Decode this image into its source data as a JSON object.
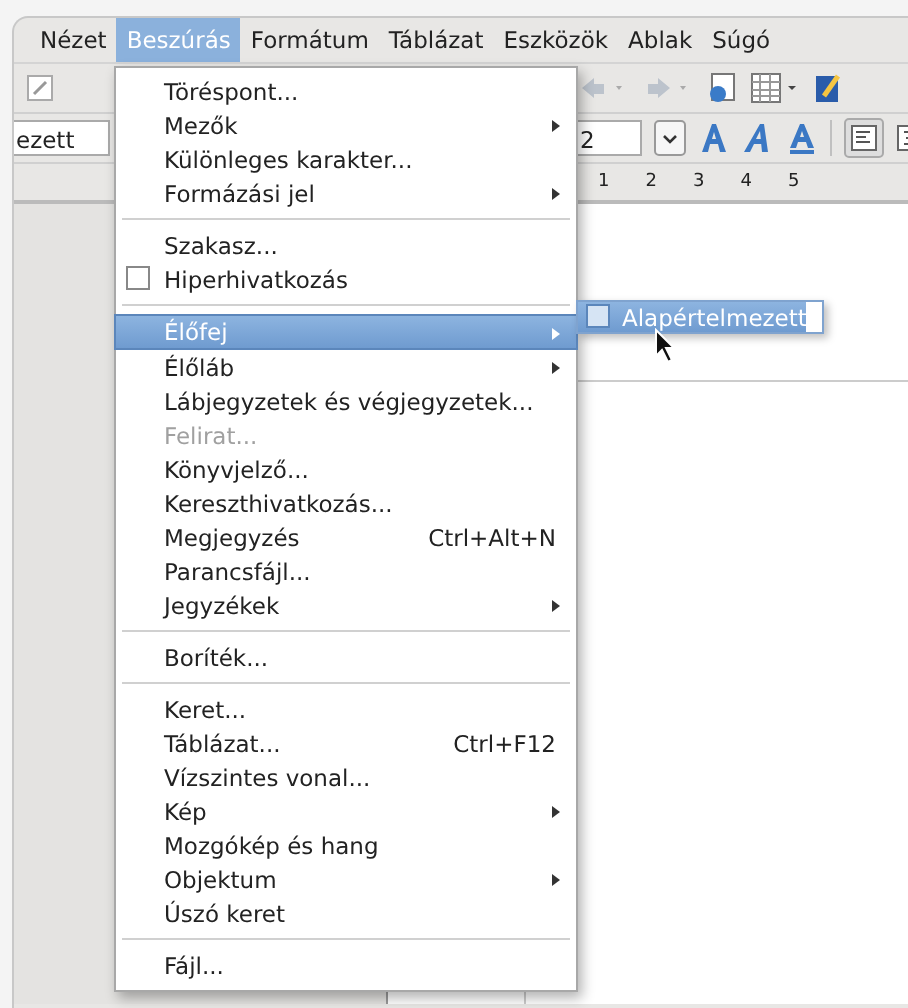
{
  "menubar": [
    {
      "label": "Nézet",
      "selected": false
    },
    {
      "label": "Beszúrás",
      "selected": true
    },
    {
      "label": "Formátum",
      "selected": false
    },
    {
      "label": "Táblázat",
      "selected": false
    },
    {
      "label": "Eszközök",
      "selected": false
    },
    {
      "label": "Ablak",
      "selected": false
    },
    {
      "label": "Súgó",
      "selected": false
    }
  ],
  "formatting": {
    "style_field": "ezett",
    "size_field": "2"
  },
  "ruler": [
    "1",
    "2",
    "3",
    "4",
    "5"
  ],
  "menu": [
    {
      "kind": "item",
      "label": "Töréspont...",
      "submenu": false,
      "disabled": false,
      "selected": false
    },
    {
      "kind": "item",
      "label": "Mezők",
      "submenu": true,
      "disabled": false,
      "selected": false
    },
    {
      "kind": "item",
      "label": "Különleges karakter...",
      "submenu": false,
      "disabled": false,
      "selected": false
    },
    {
      "kind": "item",
      "label": "Formázási jel",
      "submenu": true,
      "disabled": false,
      "selected": false
    },
    {
      "kind": "separator"
    },
    {
      "kind": "item",
      "label": "Szakasz...",
      "submenu": false,
      "disabled": false,
      "selected": false
    },
    {
      "kind": "check",
      "label": "Hiperhivatkozás",
      "checked": false,
      "disabled": false,
      "selected": false
    },
    {
      "kind": "separator"
    },
    {
      "kind": "item",
      "label": "Élőfej",
      "submenu": true,
      "disabled": false,
      "selected": true
    },
    {
      "kind": "item",
      "label": "Élőláb",
      "submenu": true,
      "disabled": false,
      "selected": false
    },
    {
      "kind": "item",
      "label": "Lábjegyzetek és végjegyzetek...",
      "submenu": false,
      "disabled": false,
      "selected": false
    },
    {
      "kind": "item",
      "label": "Felirat...",
      "submenu": false,
      "disabled": true,
      "selected": false
    },
    {
      "kind": "item",
      "label": "Könyvjelző...",
      "submenu": false,
      "disabled": false,
      "selected": false
    },
    {
      "kind": "item",
      "label": "Kereszthivatkozás...",
      "submenu": false,
      "disabled": false,
      "selected": false
    },
    {
      "kind": "item",
      "label": "Megjegyzés",
      "shortcut": "Ctrl+Alt+N",
      "submenu": false,
      "disabled": false,
      "selected": false
    },
    {
      "kind": "item",
      "label": "Parancsfájl...",
      "submenu": false,
      "disabled": false,
      "selected": false
    },
    {
      "kind": "item",
      "label": "Jegyzékek",
      "submenu": true,
      "disabled": false,
      "selected": false
    },
    {
      "kind": "separator"
    },
    {
      "kind": "item",
      "label": "Boríték...",
      "submenu": false,
      "disabled": false,
      "selected": false
    },
    {
      "kind": "separator"
    },
    {
      "kind": "item",
      "label": "Keret...",
      "submenu": false,
      "disabled": false,
      "selected": false
    },
    {
      "kind": "item",
      "label": "Táblázat...",
      "shortcut": "Ctrl+F12",
      "submenu": false,
      "disabled": false,
      "selected": false
    },
    {
      "kind": "item",
      "label": "Vízszintes vonal...",
      "submenu": false,
      "disabled": false,
      "selected": false
    },
    {
      "kind": "item",
      "label": "Kép",
      "submenu": true,
      "disabled": false,
      "selected": false
    },
    {
      "kind": "item",
      "label": "Mozgókép és hang",
      "submenu": false,
      "disabled": false,
      "selected": false
    },
    {
      "kind": "item",
      "label": "Objektum",
      "submenu": true,
      "disabled": false,
      "selected": false
    },
    {
      "kind": "item",
      "label": "Úszó keret",
      "submenu": false,
      "disabled": false,
      "selected": false
    },
    {
      "kind": "separator"
    },
    {
      "kind": "item",
      "label": "Fájl...",
      "submenu": false,
      "disabled": false,
      "selected": false
    }
  ],
  "submenu": [
    {
      "label": "Alapértelmezett",
      "checked": false,
      "selected": true
    }
  ]
}
